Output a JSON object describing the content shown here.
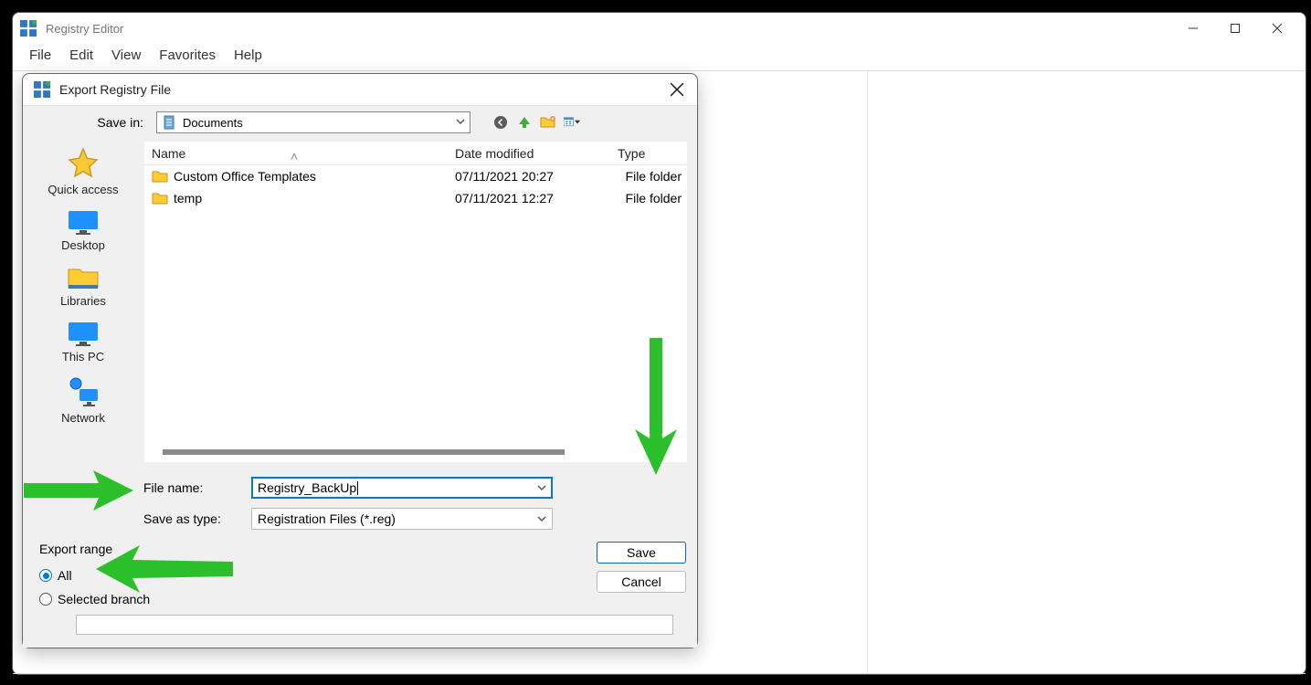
{
  "main_window": {
    "title": "Registry Editor",
    "menubar": [
      "File",
      "Edit",
      "View",
      "Favorites",
      "Help"
    ]
  },
  "dialog": {
    "title": "Export Registry File",
    "save_in_label": "Save in:",
    "save_in_value": "Documents",
    "places": {
      "quick_access": "Quick access",
      "desktop": "Desktop",
      "libraries": "Libraries",
      "this_pc": "This PC",
      "network": "Network"
    },
    "columns": {
      "name": "Name",
      "date": "Date modified",
      "type": "Type"
    },
    "rows": [
      {
        "name": "Custom Office Templates",
        "date": "07/11/2021 20:27",
        "type": "File folder"
      },
      {
        "name": "temp",
        "date": "07/11/2021 12:27",
        "type": "File folder"
      }
    ],
    "file_name_label": "File name:",
    "file_name_value": "Registry_BackUp",
    "save_as_type_label": "Save as type:",
    "save_as_type_value": "Registration Files (*.reg)",
    "save_button": "Save",
    "cancel_button": "Cancel",
    "export_range_legend": "Export range",
    "radio_all": "All",
    "radio_selected": "Selected branch"
  }
}
